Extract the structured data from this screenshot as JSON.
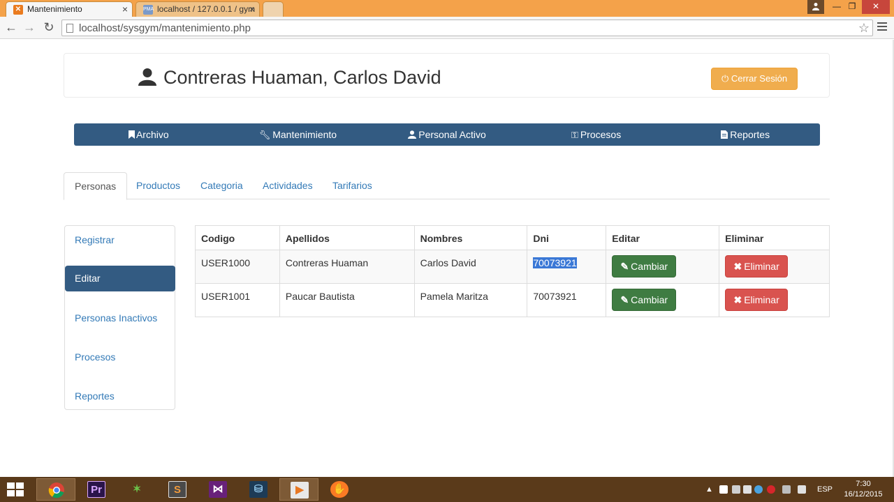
{
  "browser": {
    "tabs": [
      {
        "title": "Mantenimiento",
        "active": true
      },
      {
        "title": "localhost / 127.0.0.1 / gym",
        "active": false
      }
    ],
    "url": "localhost/sysgym/mantenimiento.php"
  },
  "header": {
    "user_name": "Contreras Huaman, Carlos David",
    "logout_label": "Cerrar Sesión"
  },
  "main_nav": [
    {
      "label": "Archivo",
      "icon": "bookmark-icon"
    },
    {
      "label": "Mantenimiento",
      "icon": "wrench-icon"
    },
    {
      "label": "Personal Activo",
      "icon": "user-icon"
    },
    {
      "label": "Procesos",
      "icon": "key-icon"
    },
    {
      "label": "Reportes",
      "icon": "file-icon"
    }
  ],
  "tabs": [
    {
      "label": "Personas",
      "active": true
    },
    {
      "label": "Productos"
    },
    {
      "label": "Categoria"
    },
    {
      "label": "Actividades"
    },
    {
      "label": "Tarifarios"
    }
  ],
  "sidebar": [
    {
      "label": "Registrar"
    },
    {
      "label": "Editar",
      "active": true
    },
    {
      "label": "Personas Inactivos"
    },
    {
      "label": "Procesos"
    },
    {
      "label": "Reportes"
    }
  ],
  "table": {
    "headers": [
      "Codigo",
      "Apellidos",
      "Nombres",
      "Dni",
      "Editar",
      "Eliminar"
    ],
    "rows": [
      {
        "codigo": "USER1000",
        "apellidos": "Contreras Huaman",
        "nombres": "Carlos David",
        "dni": "70073921",
        "edit_label": "Cambiar",
        "delete_label": "Eliminar"
      },
      {
        "codigo": "USER1001",
        "apellidos": "Paucar Bautista",
        "nombres": "Pamela Maritza",
        "dni": "70073921",
        "edit_label": "Cambiar",
        "delete_label": "Eliminar"
      }
    ]
  },
  "taskbar": {
    "apps": [
      "chrome",
      "premiere-pro",
      "camtasia",
      "sublime-text",
      "visual-studio",
      "mysql-workbench",
      "media-player",
      "xampp"
    ],
    "language": "ESP",
    "time": "7:30",
    "date": "16/12/2015"
  },
  "colors": {
    "tabstrip": "#f4a24a",
    "nav_bar": "#335b82",
    "warning": "#f0ad4e",
    "success": "#3f7c42",
    "danger": "#d9534f",
    "link": "#337ab7",
    "taskbar": "#5a3a1a"
  }
}
